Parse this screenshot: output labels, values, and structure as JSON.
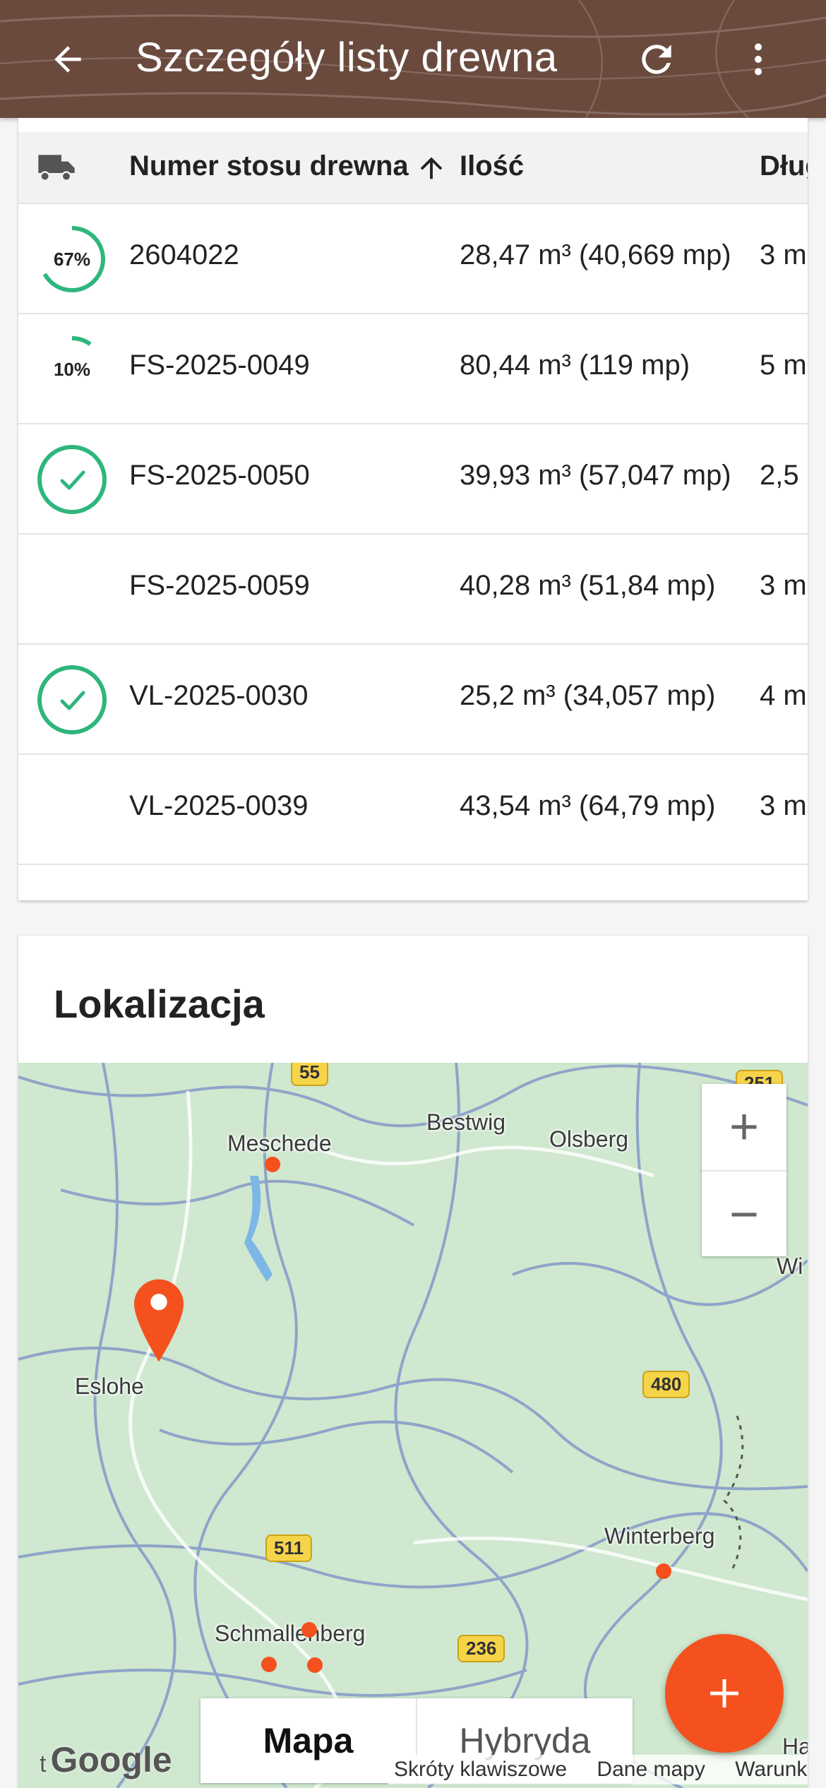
{
  "appbar": {
    "title": "Szczegóły listy drewna",
    "color": "#6b4a3e"
  },
  "table": {
    "columns": {
      "status_icon": "truck-icon",
      "number": "Numer stosu drewna",
      "sort_indicator": "arrow-up-icon",
      "quantity": "Ilość",
      "length": "Dług"
    },
    "rows": [
      {
        "status": "progress",
        "progress_label": "67%",
        "progress": 0.67,
        "number": "2604022",
        "quantity": "28,47 m³ (40,669 mp)",
        "length": "3 m"
      },
      {
        "status": "progress",
        "progress_label": "10%",
        "progress": 0.1,
        "number": "FS-2025-0049",
        "quantity": "80,44 m³ (119 mp)",
        "length": "5 m"
      },
      {
        "status": "done",
        "number": "FS-2025-0050",
        "quantity": "39,93 m³ (57,047 mp)",
        "length": "2,5"
      },
      {
        "status": "none",
        "number": "FS-2025-0059",
        "quantity": "40,28 m³ (51,84 mp)",
        "length": "3 m"
      },
      {
        "status": "done",
        "number": "VL-2025-0030",
        "quantity": "25,2 m³ (34,057 mp)",
        "length": "4 m"
      },
      {
        "status": "none",
        "number": "VL-2025-0039",
        "quantity": "43,54 m³ (64,79 mp)",
        "length": "3 m"
      }
    ],
    "status_color": "#2eb67d"
  },
  "location": {
    "title": "Lokalizacja",
    "map": {
      "places": [
        "Meschede",
        "Bestwig",
        "Olsberg",
        "Eslohe",
        "Winterberg",
        "Schmallenberg",
        "Wi",
        "Halle"
      ],
      "road_shields": [
        "55",
        "251",
        "480",
        "511",
        "236"
      ],
      "zoom_in": "+",
      "zoom_out": "−",
      "map_type_options": [
        "Mapa",
        "Hybryda"
      ],
      "selected_map_type": "Mapa",
      "logo": "Google",
      "logo_prefix": "t",
      "attribution": [
        "Skróty klawiszowe",
        "Dane mapy",
        "Warunki"
      ],
      "marker_color": "#f4511e"
    }
  },
  "fab": {
    "icon": "plus-icon",
    "color": "#f4511e"
  }
}
